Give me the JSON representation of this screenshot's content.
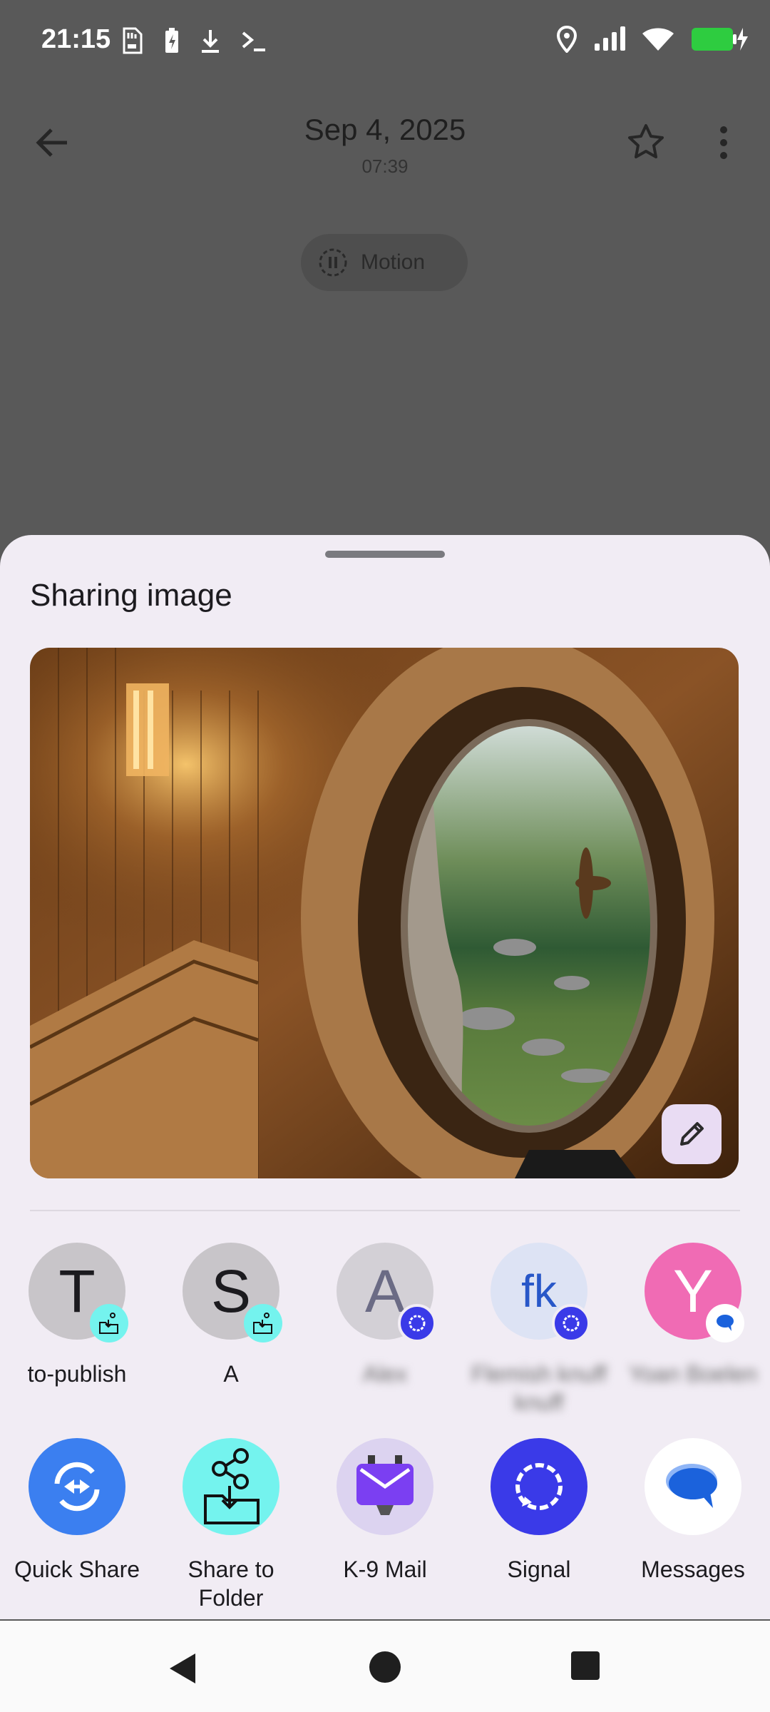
{
  "status_bar": {
    "time": "21:15",
    "left_icons": [
      "sd-card-icon",
      "battery-charging-icon",
      "download-icon",
      "terminal-icon"
    ],
    "right_icons": [
      "location-icon",
      "signal-icon",
      "wifi-icon",
      "battery-icon"
    ]
  },
  "app_bar": {
    "date": "Sep 4, 2025",
    "time": "07:39",
    "motion_label": "Motion"
  },
  "share_sheet": {
    "title": "Sharing image",
    "contacts": [
      {
        "initial": "T",
        "label": "to-publish",
        "avatar_bg": "#c8c5c9",
        "badge": "share-to-folder"
      },
      {
        "initial": "S",
        "label": "A",
        "avatar_bg": "#c8c5c9",
        "badge": "share-to-folder"
      },
      {
        "initial": "A",
        "label": "Alex",
        "avatar_bg": "#d3d0d6",
        "badge": "signal"
      },
      {
        "initial": "fk",
        "label": "Flemish knuff knuff",
        "avatar_bg": "#dde3f4",
        "badge": "signal"
      },
      {
        "initial": "Y",
        "label": "Yoan Boelen",
        "avatar_bg": "#f06bb4",
        "badge": "messages"
      }
    ],
    "apps": [
      {
        "label": "Quick Share",
        "icon": "quick-share-icon"
      },
      {
        "label": "Share to Folder",
        "icon": "share-to-folder-icon"
      },
      {
        "label": "K-9 Mail",
        "icon": "k9-mail-icon"
      },
      {
        "label": "Signal",
        "icon": "signal-app-icon"
      },
      {
        "label": "Messages",
        "icon": "messages-icon"
      }
    ]
  },
  "colors": {
    "sheet_bg": "#f1ecf4",
    "quick_share": "#3b7ff0",
    "share_to_folder": "#74f3ee",
    "k9_mail": "#7b3ff2",
    "signal": "#3a3ae8",
    "messages": "#1b62dc"
  }
}
